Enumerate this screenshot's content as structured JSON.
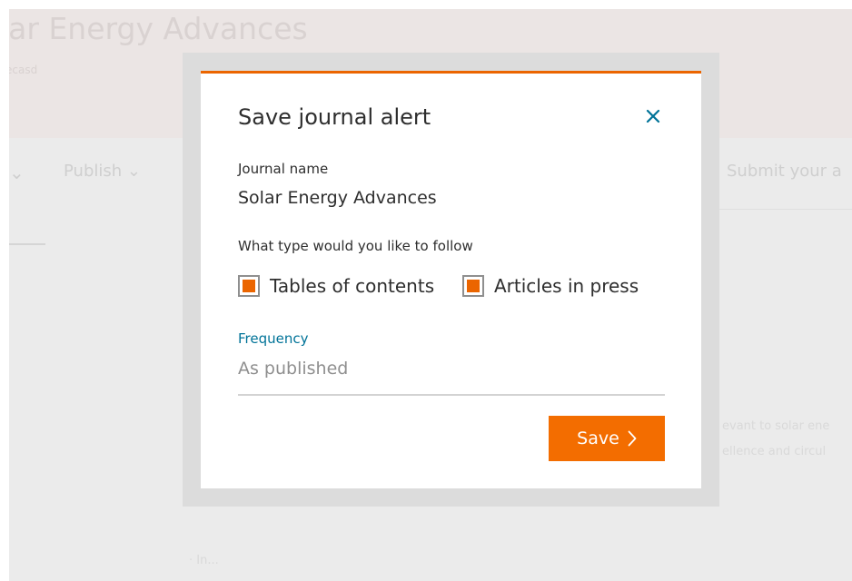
{
  "background": {
    "hero_title": "lar Energy Advances",
    "hero_subtitle": "ecasd",
    "nav_publish": "Publish ⌄",
    "nav_chevron": "⌄",
    "nav_submit": "Submit your a",
    "body_line1": "evant to solar ene",
    "body_line2": "ellence and circul",
    "body_fragment": "· In..."
  },
  "modal": {
    "title": "Save journal alert",
    "close_icon": "close-icon",
    "journal_label": "Journal name",
    "journal_value": "Solar Energy Advances",
    "type_label": "What type would you like to follow",
    "options": [
      {
        "label": "Tables of contents",
        "checked": true
      },
      {
        "label": "Articles in press",
        "checked": true
      }
    ],
    "frequency_label": "Frequency",
    "frequency_value": "As published",
    "save_label": "Save"
  },
  "colors": {
    "accent": "#eb6500",
    "button": "#f36d00",
    "link": "#007398",
    "text": "#2e2e2e"
  }
}
